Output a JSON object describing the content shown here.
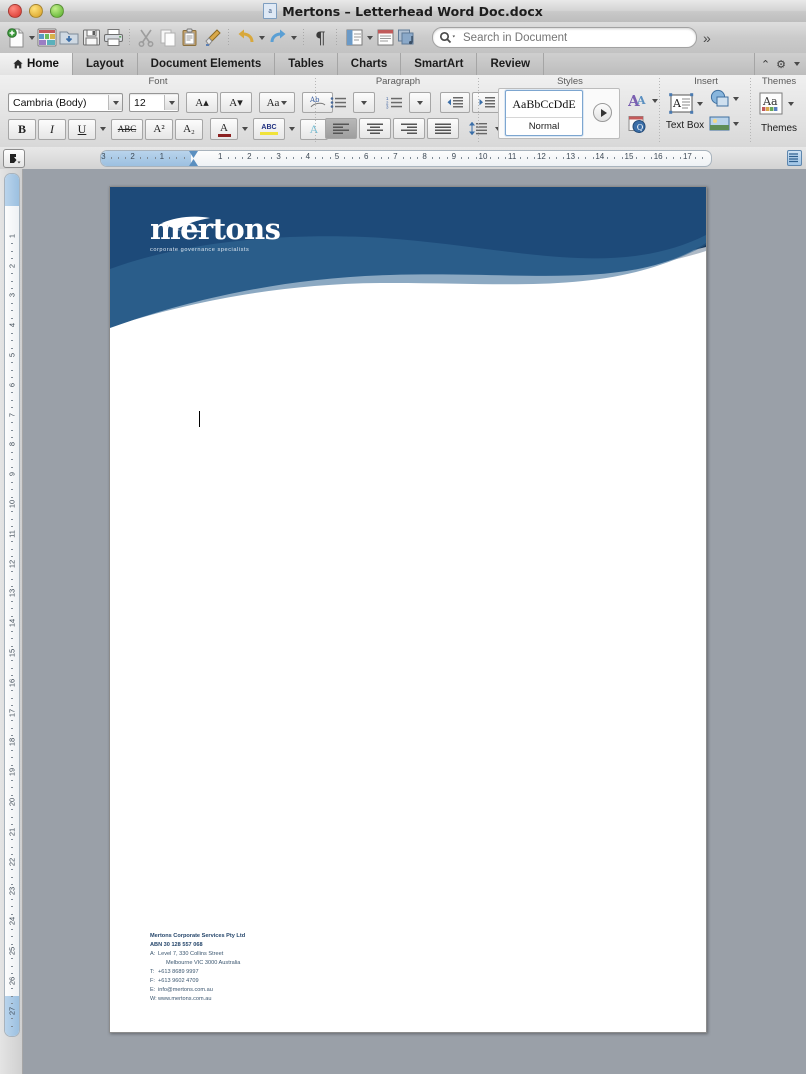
{
  "window": {
    "title": "Mertons – Letterhead Word Doc.docx",
    "doc_icon": "word-doc-icon",
    "controls": [
      "close",
      "minimize",
      "zoom"
    ]
  },
  "toolbar": {
    "items": [
      {
        "name": "new-document",
        "icon": "new-doc-icon",
        "has_menu": true
      },
      {
        "name": "new-from-template",
        "icon": "template-gallery-icon"
      },
      {
        "name": "open",
        "icon": "open-folder-icon"
      },
      {
        "name": "save",
        "icon": "floppy-save-icon"
      },
      {
        "name": "print",
        "icon": "printer-icon"
      },
      {
        "name": "cut",
        "icon": "scissors-icon"
      },
      {
        "name": "copy",
        "icon": "copy-icon"
      },
      {
        "name": "paste",
        "icon": "clipboard-paste-icon"
      },
      {
        "name": "format-painter",
        "icon": "paintbrush-icon"
      },
      {
        "name": "undo",
        "icon": "undo-arrow-icon",
        "has_menu": true
      },
      {
        "name": "redo",
        "icon": "redo-arrow-icon",
        "has_menu": true
      },
      {
        "name": "show-formatting",
        "icon": "pilcrow-icon"
      },
      {
        "name": "sidebar",
        "icon": "sidebar-panel-icon",
        "has_menu": true
      },
      {
        "name": "notebook-layout",
        "icon": "notebook-icon"
      },
      {
        "name": "media-browser",
        "icon": "media-browser-icon"
      }
    ],
    "overflow_label": "»"
  },
  "search": {
    "placeholder": "Search in Document",
    "value": "",
    "icon": "magnifier-icon"
  },
  "tabs": [
    {
      "label": "Home",
      "icon": "home-icon",
      "active": true
    },
    {
      "label": "Layout",
      "active": false
    },
    {
      "label": "Document Elements",
      "active": false
    },
    {
      "label": "Tables",
      "active": false
    },
    {
      "label": "Charts",
      "active": false
    },
    {
      "label": "SmartArt",
      "active": false
    },
    {
      "label": "Review",
      "active": false
    }
  ],
  "tab_right": [
    {
      "name": "collapse-ribbon-chevron",
      "glyph": "⌃"
    },
    {
      "name": "ribbon-settings-gear",
      "glyph": "⚙"
    }
  ],
  "ribbon": {
    "groups": [
      {
        "title": "Font",
        "font_family": {
          "value": "Cambria (Body)",
          "name": "font-family-combo"
        },
        "font_size": {
          "value": "12",
          "name": "font-size-combo"
        },
        "buttons_row1": [
          {
            "name": "grow-font-button",
            "label": "A▴"
          },
          {
            "name": "shrink-font-button",
            "label": "A▾"
          },
          {
            "name": "change-case-button",
            "label": "Aa"
          },
          {
            "name": "clear-formatting-button",
            "label": "Ab"
          }
        ],
        "buttons_row2": [
          {
            "name": "bold-button",
            "label": "B"
          },
          {
            "name": "italic-button",
            "label": "I"
          },
          {
            "name": "underline-button",
            "label": "U"
          },
          {
            "name": "strikethrough-button",
            "label": "ABC"
          },
          {
            "name": "superscript-button",
            "label": "A²"
          },
          {
            "name": "subscript-button",
            "label": "A₂"
          },
          {
            "name": "font-color-button",
            "label": "A"
          },
          {
            "name": "highlight-button",
            "label": "ABC"
          },
          {
            "name": "text-effects-button",
            "label": "A"
          }
        ]
      },
      {
        "title": "Paragraph",
        "buttons_row1": [
          {
            "name": "bullets-button",
            "label": "☰"
          },
          {
            "name": "numbering-button",
            "label": "☰"
          },
          {
            "name": "decrease-indent-button",
            "label": "⇤"
          },
          {
            "name": "increase-indent-button",
            "label": "⇥"
          }
        ],
        "buttons_row2": [
          {
            "name": "align-left-button",
            "label": "☰",
            "active": true
          },
          {
            "name": "align-center-button",
            "label": "☰"
          },
          {
            "name": "align-right-button",
            "label": "☰"
          },
          {
            "name": "justify-button",
            "label": "☰"
          },
          {
            "name": "line-spacing-button",
            "label": "↕☰"
          }
        ]
      },
      {
        "title": "Styles",
        "current_style": {
          "preview": "AaBbCcDdE",
          "name": "Normal"
        },
        "expand_button": "styles-expand-button",
        "extra_buttons": [
          {
            "name": "text-styles-button",
            "label": "AA"
          },
          {
            "name": "quick-style-button",
            "label": "Q"
          }
        ]
      },
      {
        "title": "Insert",
        "buttons": [
          {
            "name": "text-box-button",
            "label": "Text Box"
          },
          {
            "name": "shapes-button",
            "label": ""
          },
          {
            "name": "picture-button",
            "label": ""
          }
        ]
      },
      {
        "title": "Themes",
        "buttons": [
          {
            "name": "themes-button",
            "label": "Themes",
            "preview": "Aa"
          }
        ]
      }
    ]
  },
  "ruler": {
    "horizontal_ticks": [
      "3",
      "2",
      "1",
      "1",
      "2",
      "3",
      "4",
      "5",
      "6",
      "7",
      "8",
      "9",
      "10",
      "11",
      "12",
      "13",
      "14",
      "15",
      "16",
      "17"
    ],
    "vertical_ticks": [
      "2",
      "1",
      "1",
      "2",
      "3",
      "4",
      "5",
      "6",
      "7",
      "8",
      "9",
      "10",
      "11",
      "12",
      "13",
      "14",
      "15",
      "16",
      "17",
      "18",
      "19",
      "20",
      "21",
      "22",
      "23",
      "24",
      "25",
      "26",
      "27"
    ],
    "left_indent_marker": "indent-marker",
    "tab-selector": "tab-stop-selector"
  },
  "document": {
    "letterhead": {
      "logo_text": "mertons",
      "logo_tagline": "corporate governance specialists",
      "swoosh_icon": "swoosh-wave-icon",
      "band_color_dark": "#1c4a7a",
      "band_color_light": "#2f6698",
      "band_color_mid": "#2a5b8c"
    },
    "footer": {
      "company": "Mertons Corporate Services Pty Ltd",
      "abn": "ABN 30 128 557 068",
      "lines": [
        {
          "key": "A:",
          "value": "Level 7, 330 Collins Street"
        },
        {
          "key": "",
          "value": "Melbourne VIC 3000 Australia"
        },
        {
          "key": "T:",
          "value": "+613 8689 9997"
        },
        {
          "key": "F:",
          "value": "+613 9602 4709"
        },
        {
          "key": "E:",
          "value": "info@mertons.com.au"
        },
        {
          "key": "W:",
          "value": "www.mertons.com.au"
        }
      ],
      "text_color": "#3b566f"
    },
    "caret_visible": true
  }
}
